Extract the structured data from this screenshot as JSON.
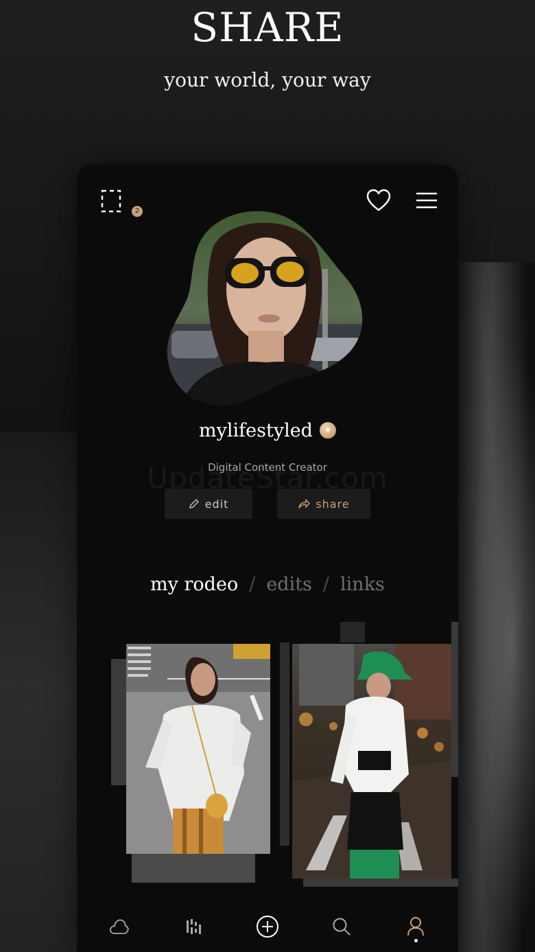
{
  "hero": {
    "title": "SHARE",
    "subtitle": "your world, your way"
  },
  "header": {
    "notification_count": "2",
    "icons": [
      "dashed-square-icon",
      "heart-icon",
      "menu-icon"
    ]
  },
  "profile": {
    "username": "mylifestyled",
    "role": "Digital Content Creator",
    "edit_label": "edit",
    "share_label": "share"
  },
  "watermark": "UpdateStar.com",
  "tabs": {
    "items": [
      "my rodeo",
      "edits",
      "links"
    ],
    "separator": "/",
    "active": 0
  },
  "nav": {
    "items": [
      "cloud-icon",
      "stats-icon",
      "add-icon",
      "search-icon",
      "profile-icon"
    ],
    "active": 4
  },
  "colors": {
    "accent": "#c9a27a",
    "background": "#0b0b0b",
    "inactive_tab": "#6f6f6f"
  }
}
